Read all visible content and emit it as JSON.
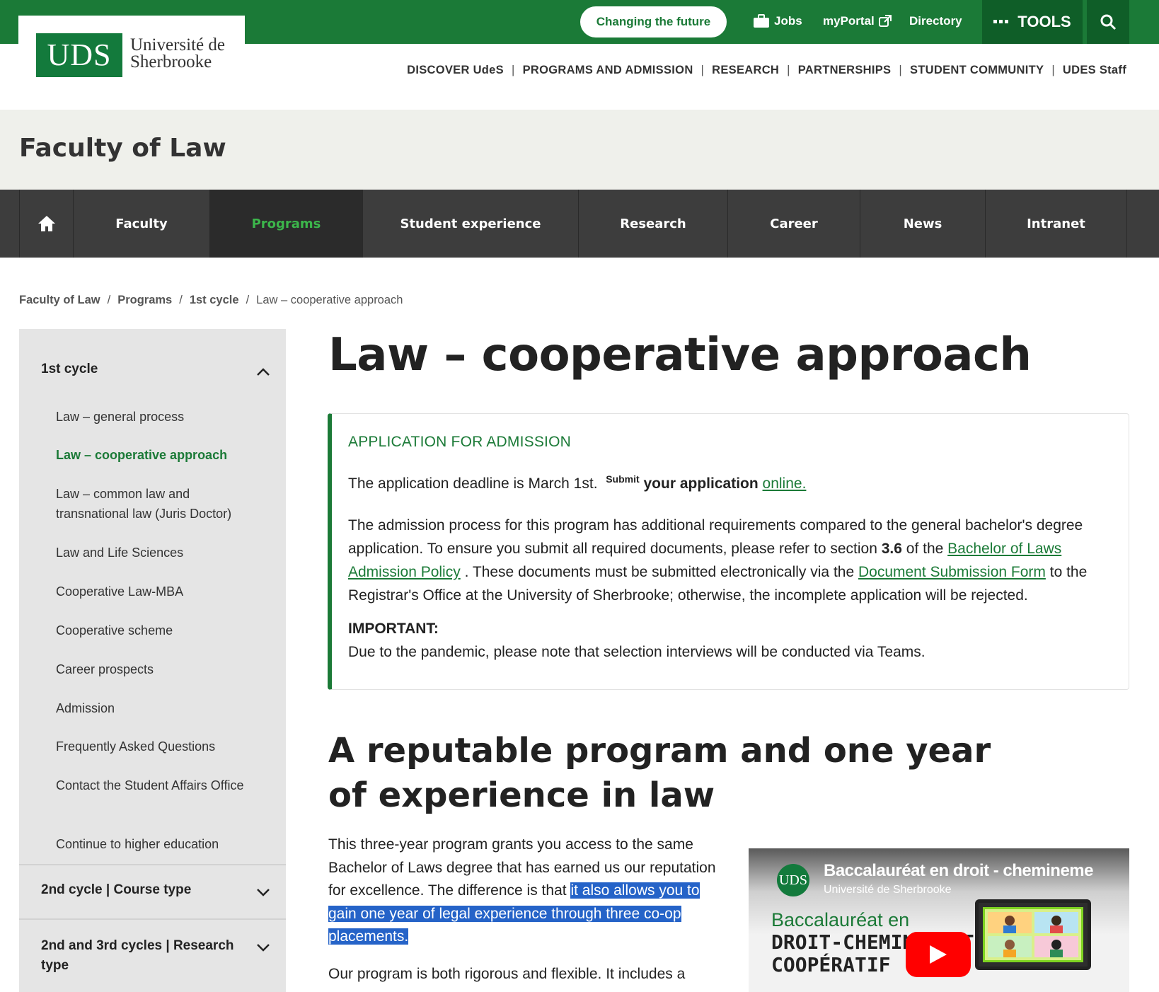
{
  "header": {
    "logo_mark": "UDS",
    "logo_line1": "Université de",
    "logo_line2": "Sherbrooke",
    "cta": "Changing the future",
    "links": {
      "jobs": "Jobs",
      "myportal": "myPortal",
      "directory": "Directory"
    },
    "tools": "TOOLS",
    "main_nav": [
      "DISCOVER UdeS",
      "PROGRAMS AND ADMISSION",
      "RESEARCH",
      "PARTNERSHIPS",
      "STUDENT COMMUNITY",
      "UDES Staff"
    ],
    "brand_color": "#1b7a37"
  },
  "faculty": {
    "title": "Faculty of Law"
  },
  "faculty_nav": [
    "Faculty",
    "Programs",
    "Student experience",
    "Research",
    "Career",
    "News",
    "Intranet"
  ],
  "breadcrumb": [
    "Faculty of Law",
    "Programs",
    "1st cycle",
    "Law – cooperative approach"
  ],
  "sidebar": {
    "section1": "1st cycle",
    "items": [
      "Law – general process",
      "Law – cooperative approach",
      "Law – common law and transnational law (Juris Doctor)",
      "Law and Life Sciences",
      "Cooperative Law-MBA",
      "Cooperative scheme",
      "Career prospects",
      "Admission",
      "Frequently Asked Questions",
      "Contact the Student Affairs Office",
      "Continue to higher education"
    ],
    "section2": "2nd cycle | Course type",
    "section3": "2nd and 3rd cycles | Research type"
  },
  "main": {
    "title": "Law – cooperative approach",
    "callout": {
      "title": "APPLICATION FOR ADMISSION",
      "deadline": "The application deadline is March 1st.",
      "submit_small": "Submit",
      "submit_bold": "your application",
      "online_link": "online.",
      "para_a": "The admission process for this program has additional requirements compared to the general bachelor's degree application. To ensure you submit all required documents, please refer to section",
      "section_no": "3.6",
      "para_b": "of the",
      "policy_link": "Bachelor of Laws Admission Policy",
      "para_c": ". These documents must be submitted electronically via the",
      "form_link": "Document Submission Form",
      "para_d": "to the Registrar's Office at the University of Sherbrooke; otherwise, the incomplete application will be rejected.",
      "important_label": "IMPORTANT:",
      "important_text": "Due to the pandemic, please note that selection interviews will be conducted via Teams."
    },
    "subtitle": "A reputable program and one year of experience in law",
    "body_a": "This three-year program grants you access to the same Bachelor of Laws degree that has earned us our reputation for excellence. The difference is that",
    "body_highlight": "it also allows you to gain one year of legal experience through three co-op placements.",
    "body_next": "Our program is both rigorous and flexible. It includes a",
    "video": {
      "logo": "UDS",
      "title": "Baccalauréat en droit - chemineme",
      "channel": "Université de Sherbrooke",
      "line1": "Baccalauréat en",
      "line2": "DROIT-CHEMINEMENT",
      "line3": "COOPÉRATIF"
    }
  }
}
